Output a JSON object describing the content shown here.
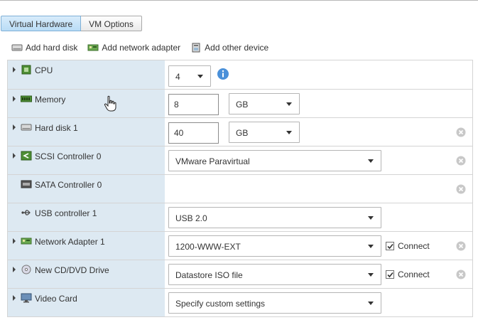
{
  "tabs": [
    {
      "label": "Virtual Hardware",
      "active": true
    },
    {
      "label": "VM Options",
      "active": false
    }
  ],
  "toolbar": {
    "add_hard_disk": "Add hard disk",
    "add_network_adapter": "Add network adapter",
    "add_other_device": "Add other device"
  },
  "devices": {
    "cpu": {
      "label": "CPU",
      "value": "4"
    },
    "memory": {
      "label": "Memory",
      "value": "8",
      "unit": "GB"
    },
    "hard_disk": {
      "label": "Hard disk 1",
      "value": "40",
      "unit": "GB"
    },
    "scsi": {
      "label": "SCSI Controller 0",
      "value": "VMware Paravirtual"
    },
    "sata": {
      "label": "SATA Controller 0"
    },
    "usb": {
      "label": "USB controller 1",
      "value": "USB 2.0"
    },
    "network": {
      "label": "Network Adapter 1",
      "value": "1200-WWW-EXT",
      "connect_label": "Connect",
      "connected": true
    },
    "cdrom": {
      "label": "New CD/DVD Drive",
      "value": "Datastore ISO file",
      "connect_label": "Connect",
      "connected": true
    },
    "video": {
      "label": "Video Card",
      "value": "Specify custom settings"
    }
  },
  "colors": {
    "left_column_bg": "#dde9f2",
    "active_tab_bg": "#b9dcf6",
    "info_icon": "#4a90d9",
    "remove_icon": "#c8c8c8"
  },
  "icons": [
    "hard-disk-icon",
    "network-adapter-icon",
    "other-device-icon",
    "cpu-icon",
    "memory-icon",
    "hard-disk-icon",
    "scsi-icon",
    "sata-icon",
    "usb-icon",
    "network-icon",
    "cdrom-icon",
    "video-card-icon",
    "info-icon",
    "remove-icon",
    "hand-cursor-icon"
  ]
}
